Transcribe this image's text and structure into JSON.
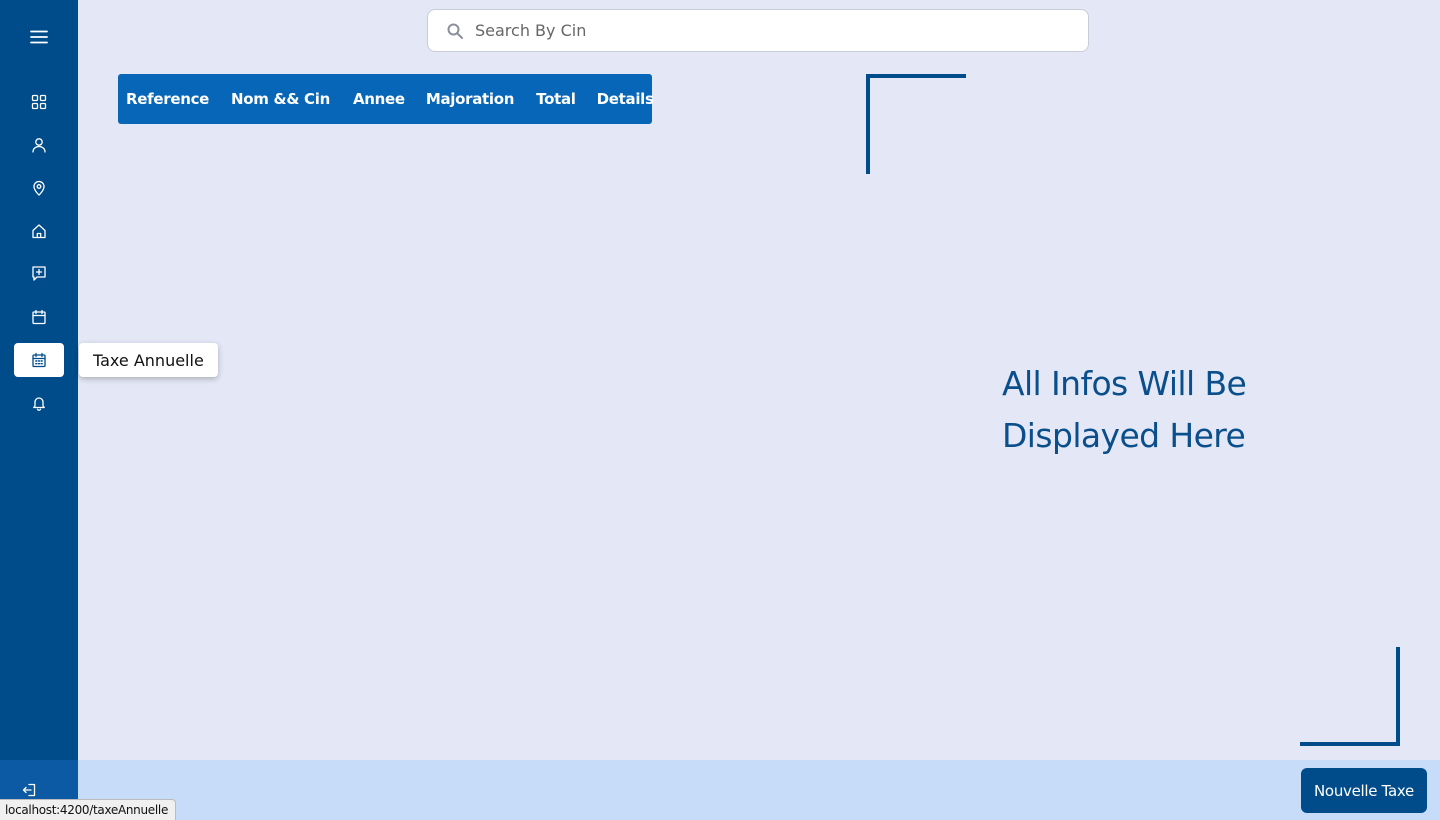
{
  "sidebar": {
    "items": [
      {
        "name": "dashboard",
        "icon": "grid-icon"
      },
      {
        "name": "users",
        "icon": "user-icon"
      },
      {
        "name": "locations",
        "icon": "map-pin-icon"
      },
      {
        "name": "properties",
        "icon": "home-icon"
      },
      {
        "name": "add-entry",
        "icon": "add-square-icon"
      },
      {
        "name": "calendar",
        "icon": "calendar-icon"
      },
      {
        "name": "taxe-annuelle",
        "icon": "calendar-grid-icon",
        "active": true
      },
      {
        "name": "notifications",
        "icon": "bell-icon"
      }
    ],
    "tooltip": "Taxe Annuelle",
    "logout_icon": "logout-icon"
  },
  "search": {
    "placeholder": "Search By Cin",
    "value": ""
  },
  "table": {
    "columns": [
      "Reference",
      "Nom && Cin",
      "Annee",
      "Majoration",
      "Total",
      "Details"
    ]
  },
  "info_panel": {
    "text": "All Infos Will Be Displayed Here"
  },
  "footer": {
    "new_button_label": "Nouvelle Taxe"
  },
  "status_bar": {
    "url": "localhost:4200/taxeAnnuelle"
  },
  "colors": {
    "sidebar": "#004c8a",
    "background": "#e4e8f6",
    "table_header": "#0766b7",
    "footer": "#c7dcf9",
    "accent_text": "#0a4f8c"
  }
}
